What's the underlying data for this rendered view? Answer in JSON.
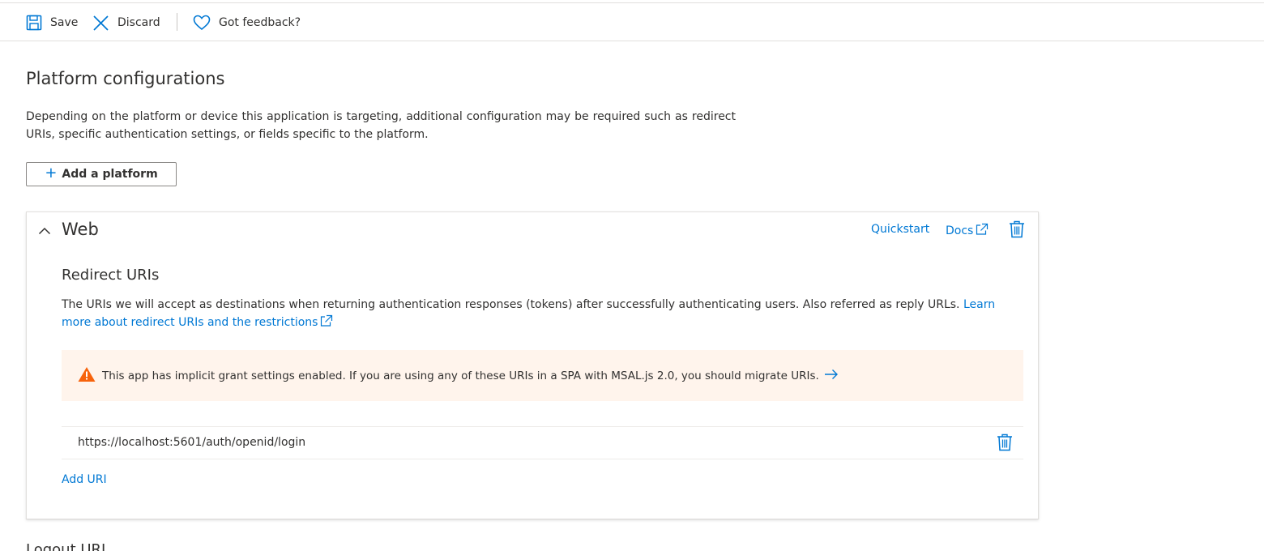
{
  "toolbar": {
    "save_label": "Save",
    "discard_label": "Discard",
    "feedback_label": "Got feedback?"
  },
  "page": {
    "title": "Platform configurations",
    "description": "Depending on the platform or device this application is targeting, additional configuration may be required such as redirect URIs, specific authentication settings, or fields specific to the platform.",
    "add_platform_label": "Add a platform"
  },
  "web_card": {
    "title": "Web",
    "quickstart_label": "Quickstart",
    "docs_label": "Docs",
    "redirect_heading": "Redirect URIs",
    "redirect_desc": "The URIs we will accept as destinations when returning authentication responses (tokens) after successfully authenticating users. Also referred as reply URLs.",
    "learn_more_label": "Learn more about redirect URIs and the restrictions",
    "warning_text": "This app has implicit grant settings enabled. If you are using any of these URIs in a SPA with MSAL.js 2.0, you should migrate URIs.",
    "uris": [
      "https://localhost:5601/auth/openid/login"
    ],
    "add_uri_label": "Add URI"
  },
  "next_section": {
    "title": "Logout URL"
  },
  "colors": {
    "accent": "#0078d4",
    "warning_bg": "#fff4ec",
    "warning_icon": "#f7630c"
  },
  "icons": {
    "save": "save-icon",
    "discard": "close-icon",
    "feedback": "heart-icon",
    "collapse": "chevron-up-icon",
    "delete": "trash-icon",
    "external": "external-link-icon",
    "warning": "warning-icon",
    "arrow": "arrow-right-icon"
  }
}
